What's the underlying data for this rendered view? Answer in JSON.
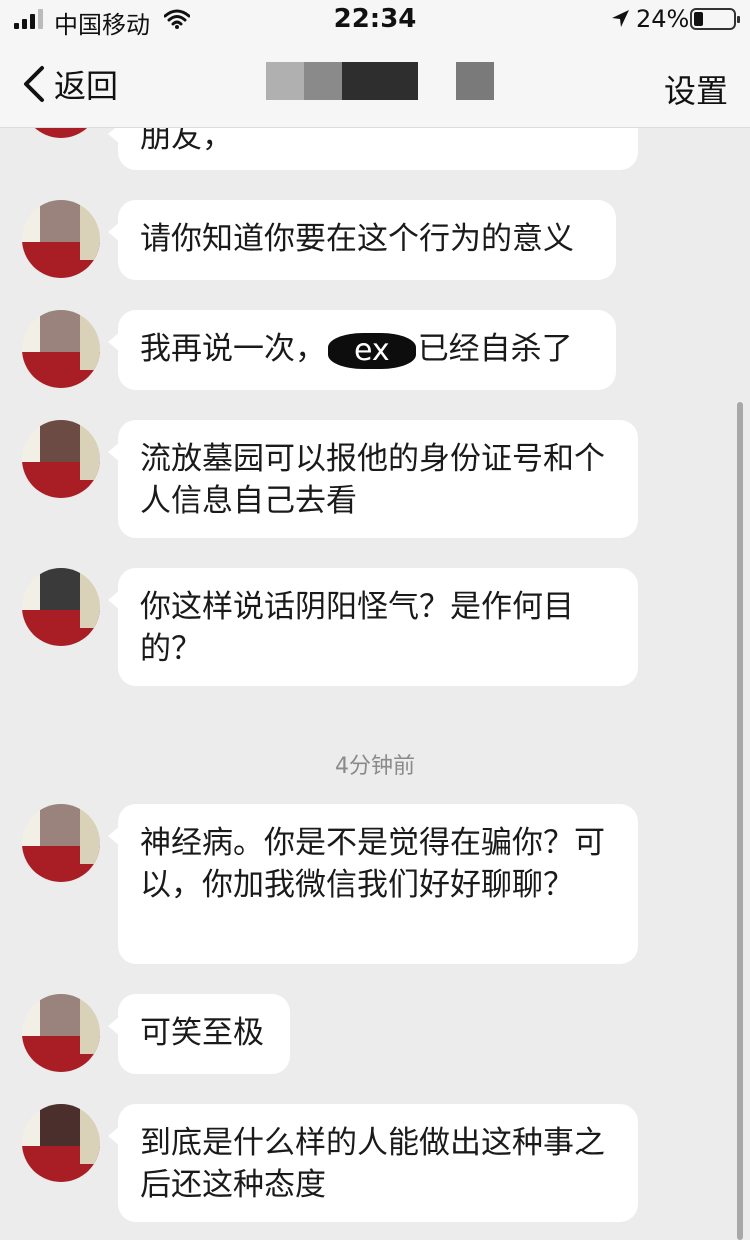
{
  "status_bar": {
    "carrier": "中国移动",
    "time": "22:34",
    "battery_percent": "24%",
    "battery_level": 0.24,
    "icons": [
      "signal-icon",
      "wifi-icon",
      "location-arrow-icon",
      "battery-icon"
    ]
  },
  "nav": {
    "back_label": "返回",
    "settings_label": "设置"
  },
  "messages": [
    {
      "text": "朋友，",
      "partial": true
    },
    {
      "text": "请你知道你要在这个行为的意义"
    },
    {
      "before": "我再说一次，",
      "redacted": "ex",
      "after": "已经自杀了"
    },
    {
      "text": "流放墓园可以报他的身份证号和个人信息自己去看"
    },
    {
      "text": "你这样说话阴阳怪气？是作何目的？"
    },
    {
      "text": "神经病。你是不是觉得在骗你？可以，你加我微信我们好好聊聊？"
    },
    {
      "text": "可笑至极"
    },
    {
      "text": "到底是什么样的人能做出这种事之后还这种态度"
    }
  ],
  "timestamp": "4分钟前",
  "colors": {
    "background": "#ececec",
    "bubble": "#ffffff",
    "header": "#f6f6f6",
    "avatar_red": "#a81e24"
  }
}
